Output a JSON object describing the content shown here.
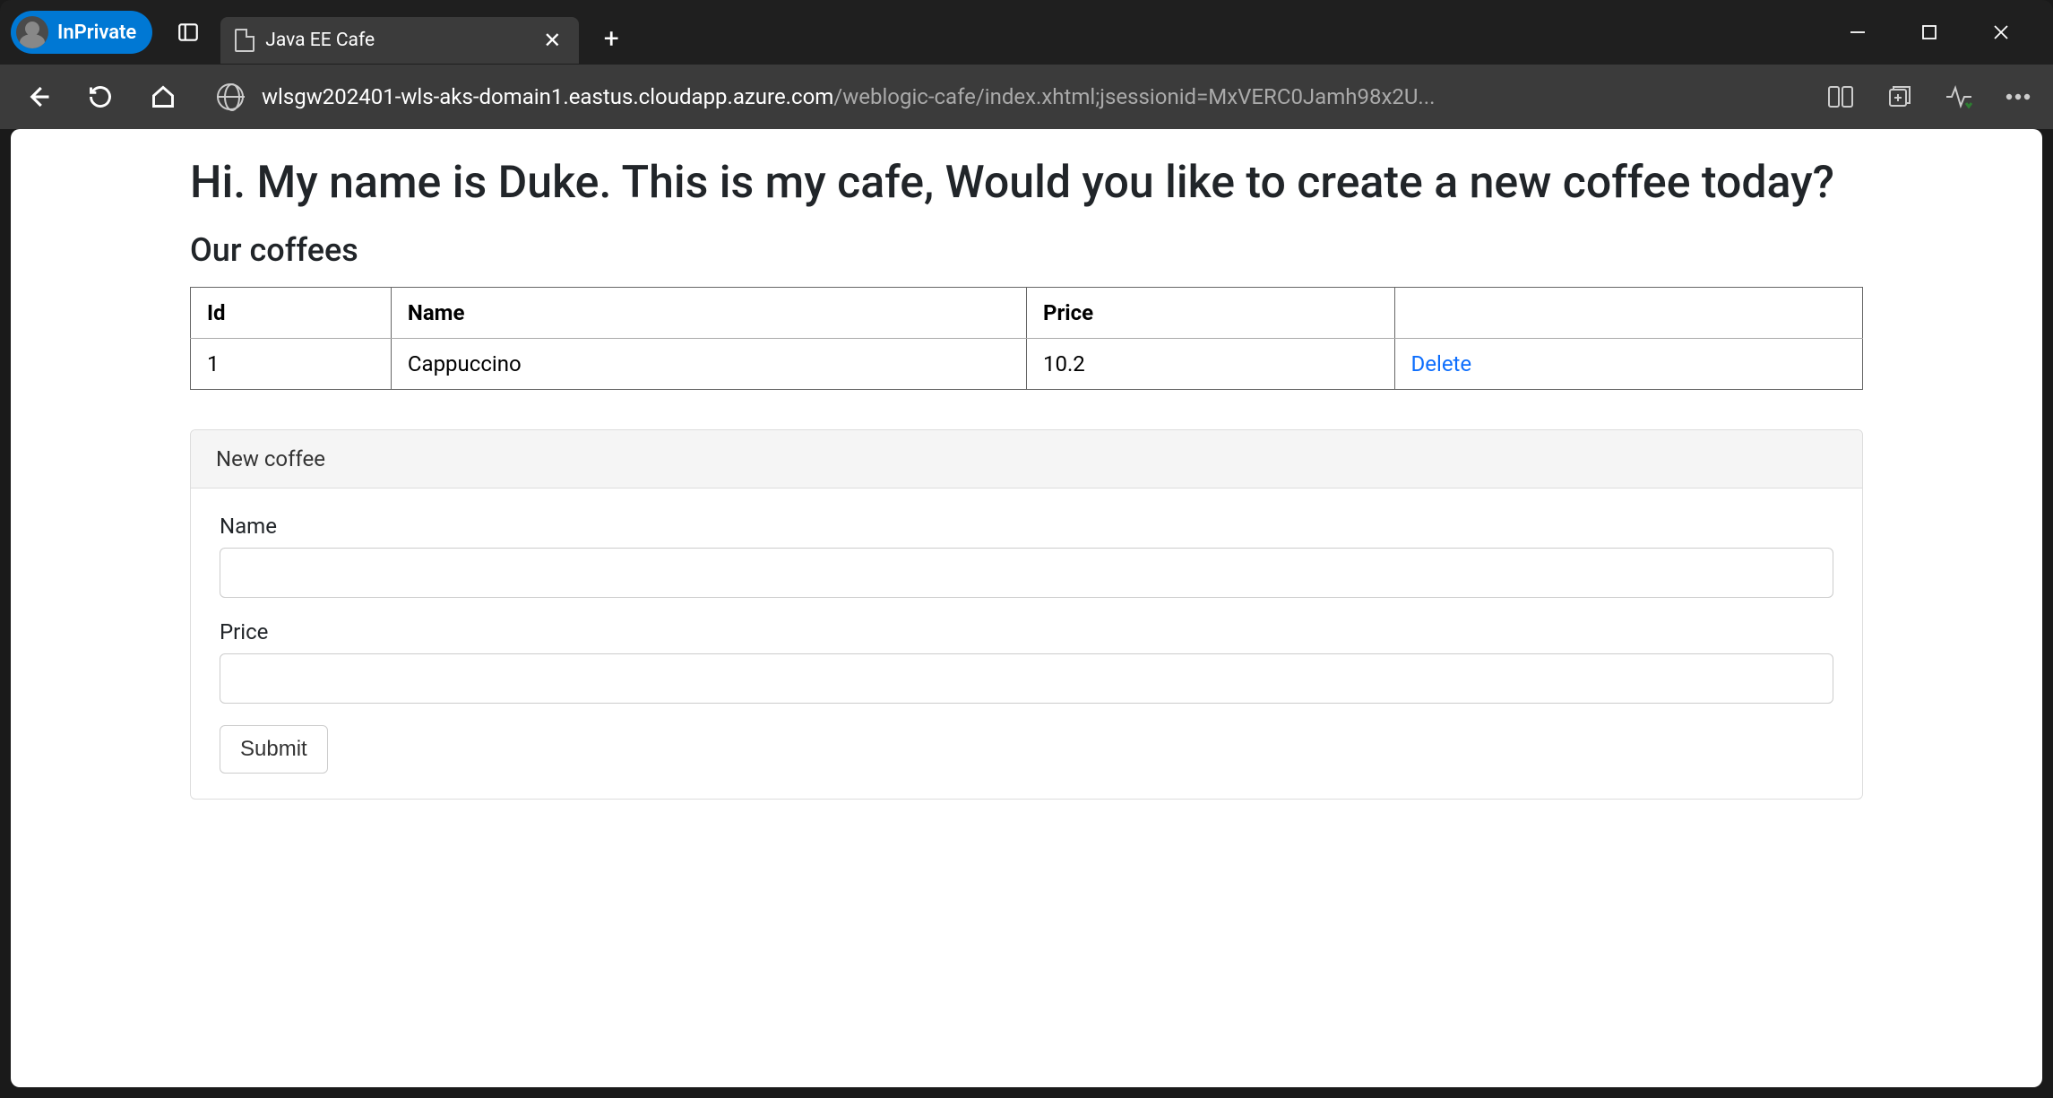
{
  "browser": {
    "inprivate_label": "InPrivate",
    "tab_title": "Java EE Cafe",
    "url_host": "wlsgw202401-wls-aks-domain1.eastus.cloudapp.azure.com",
    "url_path": "/weblogic-cafe/index.xhtml;jsessionid=MxVERC0Jamh98x2U..."
  },
  "page": {
    "heading": "Hi. My name is Duke. This is my cafe, Would you like to create a new coffee today?",
    "subheading": "Our coffees",
    "table": {
      "headers": {
        "id": "Id",
        "name": "Name",
        "price": "Price"
      },
      "rows": [
        {
          "id": "1",
          "name": "Cappuccino",
          "price": "10.2",
          "action": "Delete"
        }
      ]
    },
    "form": {
      "title": "New coffee",
      "name_label": "Name",
      "name_value": "",
      "price_label": "Price",
      "price_value": "",
      "submit_label": "Submit"
    }
  }
}
